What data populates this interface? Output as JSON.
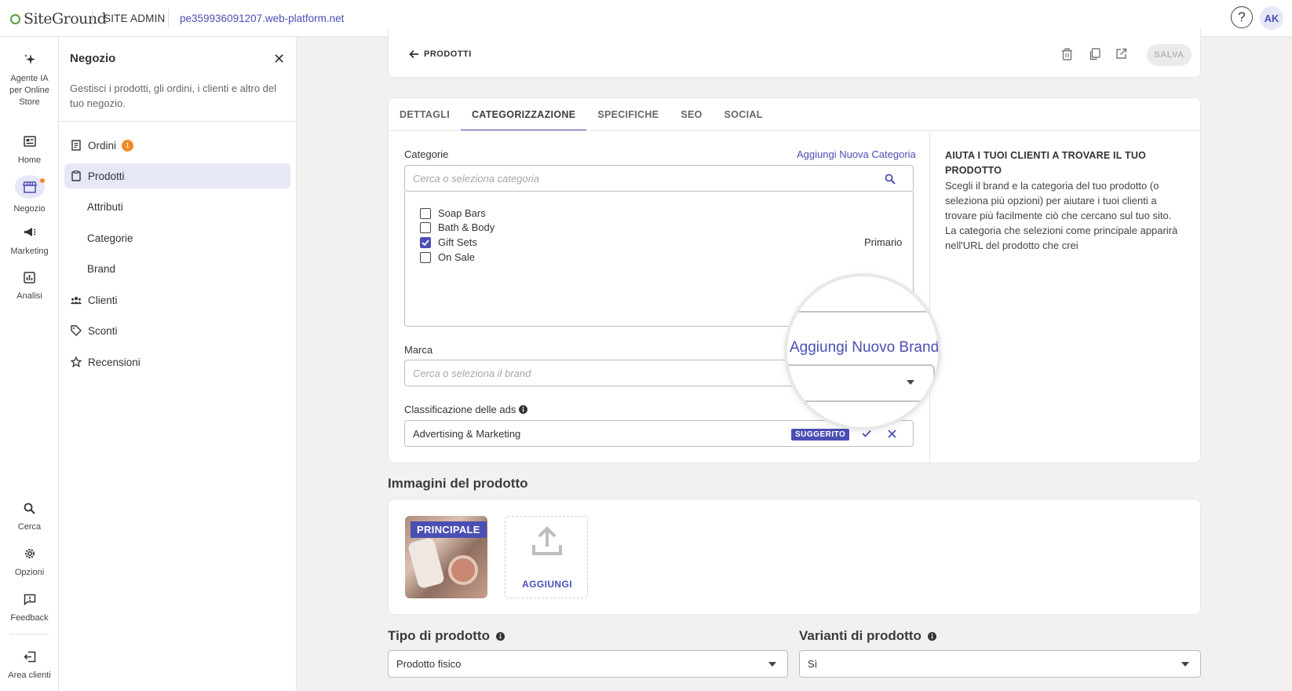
{
  "topbar": {
    "brand": "SiteGround",
    "section": "SITE ADMIN",
    "site_url": "pe359936091207.web-platform.net",
    "help_label": "?",
    "avatar_initials": "AK"
  },
  "rail": {
    "items": [
      {
        "label": "Agente IA per Online Store",
        "icon": "sparkle-icon"
      },
      {
        "label": "Home",
        "icon": "home-icon"
      },
      {
        "label": "Negozio",
        "icon": "store-icon",
        "active": true
      },
      {
        "label": "Marketing",
        "icon": "megaphone-icon"
      },
      {
        "label": "Analisi",
        "icon": "chart-icon"
      }
    ],
    "bottom_items": [
      {
        "label": "Cerca",
        "icon": "search-icon"
      },
      {
        "label": "Opzioni",
        "icon": "gear-icon"
      },
      {
        "label": "Feedback",
        "icon": "feedback-icon"
      },
      {
        "label": "Area clienti",
        "icon": "logout-icon"
      }
    ]
  },
  "panel": {
    "title": "Negozio",
    "description": "Gestisci i prodotti, gli ordini, i clienti e altro del tuo negozio.",
    "nav": [
      {
        "label": "Ordini",
        "badge": "1"
      },
      {
        "label": "Prodotti"
      },
      {
        "label": "Attributi"
      },
      {
        "label": "Categorie"
      },
      {
        "label": "Brand"
      },
      {
        "label": "Clienti"
      },
      {
        "label": "Sconti"
      },
      {
        "label": "Recensioni"
      }
    ]
  },
  "header": {
    "back_label": "PRODOTTI",
    "save_label": "SALVA"
  },
  "tabs": [
    "DETTAGLI",
    "CATEGORIZZAZIONE",
    "SPECIFICHE",
    "SEO",
    "SOCIAL"
  ],
  "form": {
    "categories_label": "Categorie",
    "add_category_link": "Aggiungi Nuova Categoria",
    "categories_placeholder": "Cerca o seleziona categoria",
    "categories": [
      {
        "name": "Soap Bars",
        "checked": false
      },
      {
        "name": "Bath & Body",
        "checked": false
      },
      {
        "name": "Gift Sets",
        "checked": true,
        "tag": "Primario"
      },
      {
        "name": "On Sale",
        "checked": false
      }
    ],
    "brand_label": "Marca",
    "brand_placeholder": "Cerca o seleziona il brand",
    "add_brand_link": "Aggiungi Nuovo Brand",
    "ads_label": "Classificazione delle ads",
    "ads_value": "Advertising & Marketing",
    "ads_badge": "SUGGERITO"
  },
  "help": {
    "title": "AIUTA I TUOI CLIENTI A TROVARE IL TUO PRODOTTO",
    "text": "Scegli il brand e la categoria del tuo prodotto (o seleziona più opzioni) per aiutare i tuoi clienti a trovare più facilmente ciò che cercano sul tuo sito. La categoria che selezioni come principale apparirà nell'URL del prodotto che crei"
  },
  "images": {
    "heading": "Immagini del prodotto",
    "main_tag": "PRINCIPALE",
    "add_label": "AGGIUNGI"
  },
  "product_type": {
    "label": "Tipo di prodotto",
    "value": "Prodotto fisico"
  },
  "variants": {
    "label": "Varianti di prodotto",
    "value": "Sì"
  },
  "colors": {
    "accent": "#4b4fb3",
    "badge": "#f08a24"
  }
}
